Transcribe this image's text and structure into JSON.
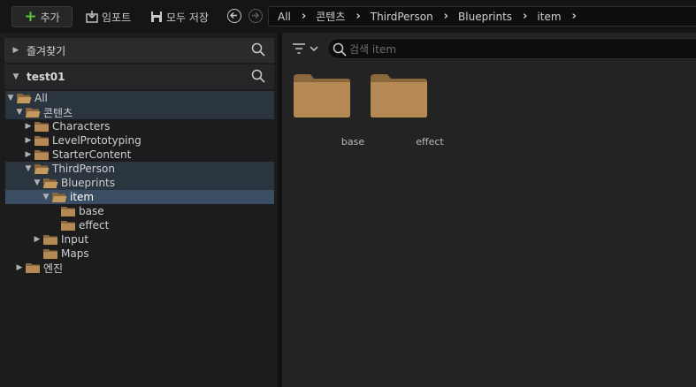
{
  "toolbar": {
    "add_label": "추가",
    "import_label": "임포트",
    "saveall_label": "모두 저장"
  },
  "breadcrumb": [
    "All",
    "콘텐츠",
    "ThirdPerson",
    "Blueprints",
    "item"
  ],
  "favorites": {
    "label": "즐겨찾기"
  },
  "project": {
    "label": "test01"
  },
  "tree": [
    {
      "label": "All",
      "depth": 0,
      "arrow": "down",
      "open": true,
      "sel": "sel1"
    },
    {
      "label": "콘텐츠",
      "depth": 1,
      "arrow": "down",
      "open": true,
      "sel": "sel1"
    },
    {
      "label": "Characters",
      "depth": 2,
      "arrow": "right",
      "open": false,
      "sel": ""
    },
    {
      "label": "LevelPrototyping",
      "depth": 2,
      "arrow": "right",
      "open": false,
      "sel": ""
    },
    {
      "label": "StarterContent",
      "depth": 2,
      "arrow": "right",
      "open": false,
      "sel": ""
    },
    {
      "label": "ThirdPerson",
      "depth": 2,
      "arrow": "down",
      "open": true,
      "sel": "sel1"
    },
    {
      "label": "Blueprints",
      "depth": 3,
      "arrow": "down",
      "open": true,
      "sel": "sel1"
    },
    {
      "label": "item",
      "depth": 4,
      "arrow": "down",
      "open": true,
      "sel": "sel2"
    },
    {
      "label": "base",
      "depth": 5,
      "arrow": "",
      "open": false,
      "sel": ""
    },
    {
      "label": "effect",
      "depth": 5,
      "arrow": "",
      "open": false,
      "sel": ""
    },
    {
      "label": "Input",
      "depth": 3,
      "arrow": "right",
      "open": false,
      "sel": ""
    },
    {
      "label": "Maps",
      "depth": 3,
      "arrow": "",
      "open": false,
      "sel": ""
    },
    {
      "label": "엔진",
      "depth": 1,
      "arrow": "right",
      "open": false,
      "sel": ""
    }
  ],
  "search": {
    "placeholder": "검색 item"
  },
  "assets": [
    "base",
    "effect"
  ],
  "colors": {
    "folder": "#b58a55",
    "folder_dark": "#8a673d",
    "accent_plus": "#5fc23d",
    "selection": "#3b4d63"
  }
}
